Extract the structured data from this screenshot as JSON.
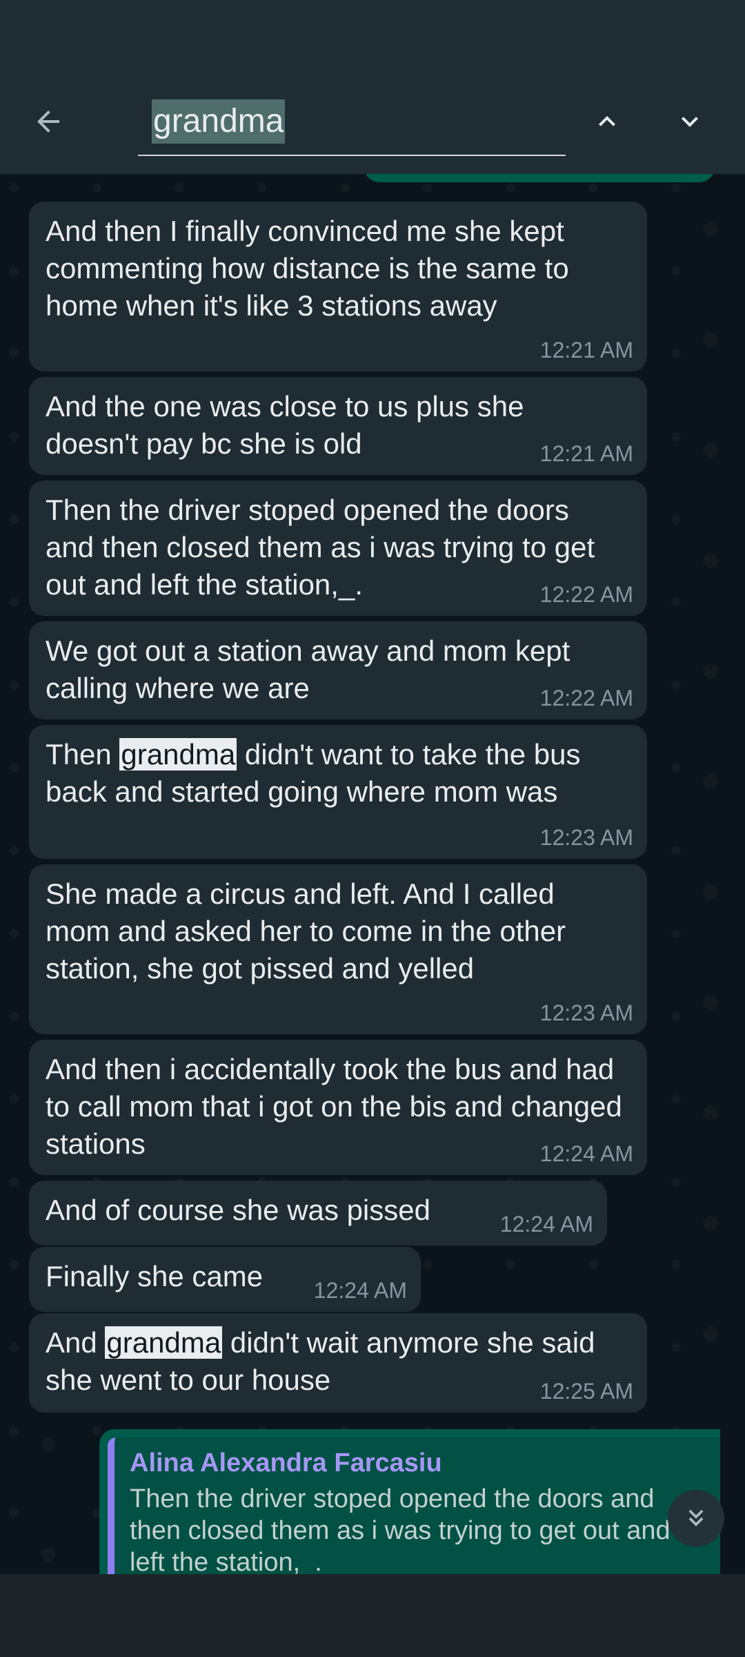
{
  "search": {
    "query": "grandma"
  },
  "messages": [
    {
      "text": "And then I finally convinced me she kept commenting how distance is the same to home when it's like 3 stations away",
      "time": "12:21 AM"
    },
    {
      "text": "And the one was close to us plus she doesn't pay bc she is old",
      "time": "12:21 AM"
    },
    {
      "text": "Then the driver stoped opened the doors and then closed them as i was trying to get out and left the station,_.",
      "time": "12:22 AM"
    },
    {
      "text": "We got out a station away and mom kept calling where we are",
      "time": "12:22 AM"
    },
    {
      "pre": "Then ",
      "hl": "grandma",
      "post": " didn't want to take the bus back and started going where mom was",
      "time": "12:23 AM"
    },
    {
      "text": "She made a circus and left. And I called mom and asked her to come in the other station, she got pissed and yelled",
      "time": "12:23 AM"
    },
    {
      "text": "And then i accidentally took the bus and had to call mom that i got on the bis and changed stations",
      "time": "12:24 AM"
    },
    {
      "text": "And of course she was pissed",
      "time": "12:24 AM"
    },
    {
      "text": "Finally she came",
      "time": "12:24 AM"
    },
    {
      "pre": "And ",
      "hl": "grandma",
      "post": " didn't wait anymore she said she went to our house",
      "time": "12:25 AM"
    }
  ],
  "reply": {
    "author": "Alina Alexandra Farcasiu",
    "quoted_text": "Then the driver stoped opened the doors and then closed them as i was trying to get out and left the station,_."
  },
  "icons": {
    "back": "arrow-left-icon",
    "up": "chevron-up-icon",
    "down": "chevron-down-icon",
    "scroll": "double-chevron-down-icon"
  },
  "colors": {
    "incoming_bubble": "#202c33",
    "outgoing_bubble": "#005c4b",
    "background": "#0b141a",
    "header": "#1f2c34",
    "reply_name": "#a597f5"
  }
}
